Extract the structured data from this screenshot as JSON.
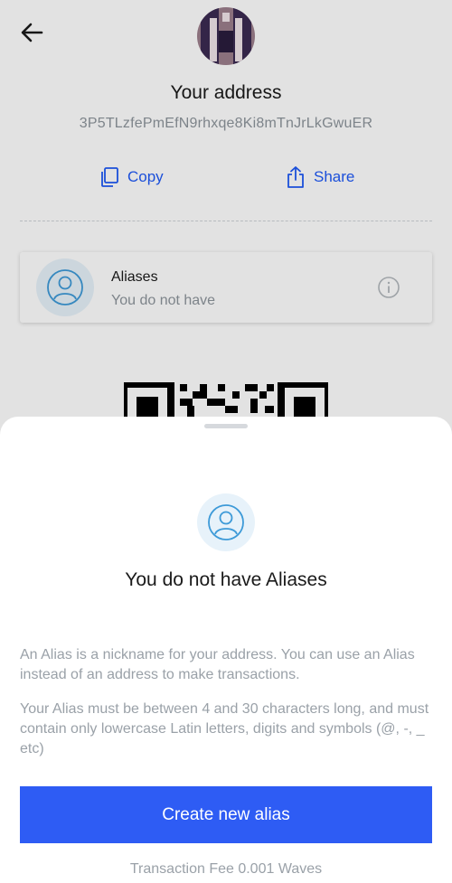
{
  "header": {
    "title": "Your address",
    "address": "3P5TLzfePmEfN9rhxqe8Ki8mTnJrLkGwuER"
  },
  "actions": {
    "copy_label": "Copy",
    "share_label": "Share"
  },
  "alias_card": {
    "label": "Aliases",
    "status": "You do not have"
  },
  "sheet": {
    "title": "You do not have Aliases",
    "description": "An Alias is a nickname for your address. You can use an Alias instead of an address to make transactions.",
    "rules": "Your Alias must be between 4 and 30 characters long, and must contain only lowercase Latin letters, digits and symbols (@, -, _ etc)",
    "create_button_label": "Create new alias",
    "fee_text": "Transaction Fee 0.001 Waves"
  },
  "icons": {
    "back": "arrow-left-icon",
    "copy": "copy-icon",
    "share": "share-icon",
    "user": "user-icon",
    "info": "info-icon"
  },
  "colors": {
    "accent": "#1f5af6",
    "button": "#2e5cf4",
    "muted_text": "#8e959c",
    "icon_circle_bg": "#e7f2fa",
    "icon_stroke": "#3d9ad8"
  }
}
